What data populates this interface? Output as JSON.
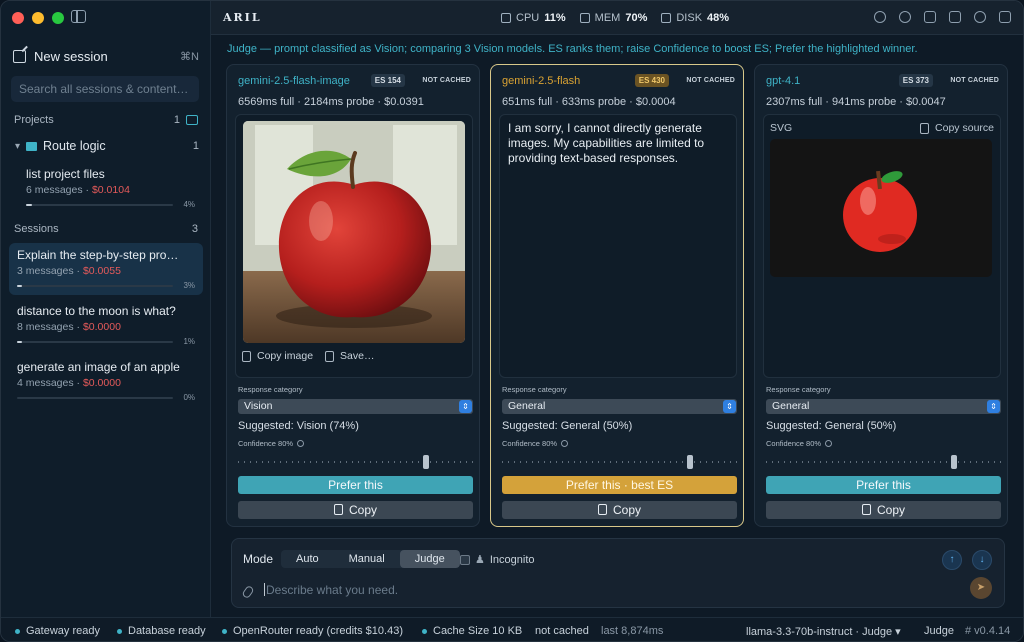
{
  "app": {
    "brand": "ARIL"
  },
  "colors": {
    "accent": "#3fb3c7",
    "best": "#d4a23a",
    "cost": "#e45a5a",
    "chevron_blue": "#2f7fe0"
  },
  "sidebar": {
    "new_session": "New session",
    "new_session_shortcut": "⌘N",
    "search_placeholder": "Search all sessions & content…",
    "projects_label": "Projects",
    "projects_count": "1",
    "project": {
      "name": "Route logic",
      "count": "1"
    },
    "project_items": [
      {
        "title": "list project files",
        "messages": "6 messages · ",
        "cost": "$0.0104",
        "pct": "4%",
        "progress": 0.04
      }
    ],
    "sessions_label": "Sessions",
    "sessions_count": "3",
    "sessions": [
      {
        "title": "Explain the step-by-step pro…",
        "messages": "3 messages · ",
        "cost": "$0.0055",
        "pct": "3%",
        "progress": 0.03
      },
      {
        "title": "distance to the moon is what?",
        "messages": "8 messages · ",
        "cost": "$0.0000",
        "pct": "1%",
        "progress": 0.01
      },
      {
        "title": "generate an image of an apple",
        "messages": "4 messages · ",
        "cost": "$0.0000",
        "pct": "0%",
        "progress": 0.0
      }
    ]
  },
  "topbar": {
    "cpu_label": "CPU",
    "cpu": "11%",
    "mem_label": "MEM",
    "mem": "70%",
    "disk_label": "DISK",
    "disk": "48%"
  },
  "judge_line": "Judge — prompt classified as Vision; comparing 3 Vision models. ES ranks them; raise Confidence to boost ES; Prefer the highlighted winner.",
  "cards": [
    {
      "model": "gemini-2.5-flash-image",
      "es": "ES 154",
      "cache": "NOT CACHED",
      "timing": "6569ms full · 2184ms probe · $0.0391",
      "copy_image": "Copy image",
      "save": "Save…",
      "category_label": "Response category",
      "category": "Vision",
      "suggested": "Suggested: Vision (74%)",
      "confidence": "Confidence 80%",
      "confidence_value": 0.8,
      "prefer": "Prefer this",
      "copy": "Copy"
    },
    {
      "model": "gemini-2.5-flash",
      "es": "ES 430",
      "cache": "NOT CACHED",
      "timing": "651ms full · 633ms probe · $0.0004",
      "response": "I am sorry, I cannot directly generate images. My capabilities are limited to providing text-based responses.",
      "category_label": "Response category",
      "category": "General",
      "suggested": "Suggested: General (50%)",
      "confidence": "Confidence 80%",
      "confidence_value": 0.8,
      "prefer": "Prefer this · best ES",
      "copy": "Copy"
    },
    {
      "model": "gpt-4.1",
      "es": "ES 373",
      "cache": "NOT CACHED",
      "timing": "2307ms full · 941ms probe · $0.0047",
      "svg_label": "SVG",
      "copy_source": "Copy source",
      "category_label": "Response category",
      "category": "General",
      "suggested": "Suggested: General (50%)",
      "confidence": "Confidence 80%",
      "confidence_value": 0.8,
      "prefer": "Prefer this",
      "copy": "Copy"
    }
  ],
  "composer": {
    "mode_label": "Mode",
    "modes": [
      "Auto",
      "Manual",
      "Judge"
    ],
    "active_mode": "Judge",
    "incognito": "Incognito",
    "placeholder": "Describe what you need."
  },
  "status": {
    "gateway": "Gateway ready",
    "database": "Database ready",
    "openrouter": "OpenRouter ready (credits $10.43)",
    "cache": "Cache Size 10 KB",
    "not_cached": "not cached",
    "last": "last 8,874ms",
    "model": "llama-3.3-70b-instruct · Judge ▾",
    "mode": "Judge",
    "version": "# v0.4.14"
  }
}
